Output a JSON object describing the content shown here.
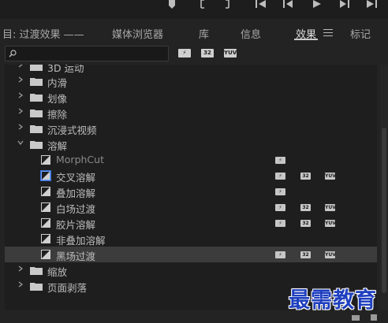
{
  "tabs": [
    {
      "label": "目: 过渡效果 ——",
      "active": false
    },
    {
      "label": "媒体浏览器",
      "active": false
    },
    {
      "label": "库",
      "active": false
    },
    {
      "label": "信息",
      "active": false
    },
    {
      "label": "效果",
      "active": true
    },
    {
      "label": "标记",
      "active": false
    }
  ],
  "toolbar": {
    "search_value": "",
    "filters": [
      "accelerated-effects",
      "32-bit-color",
      "yuv"
    ]
  },
  "badges": {
    "fx": "⚡",
    "b32": "32",
    "yuv": "YUV"
  },
  "tree": [
    {
      "type": "folder",
      "label": "3D 运动",
      "expanded": false,
      "clipped": true
    },
    {
      "type": "folder",
      "label": "内滑",
      "expanded": false
    },
    {
      "type": "folder",
      "label": "划像",
      "expanded": false
    },
    {
      "type": "folder",
      "label": "擦除",
      "expanded": false
    },
    {
      "type": "folder",
      "label": "沉浸式视频",
      "expanded": false
    },
    {
      "type": "folder",
      "label": "溶解",
      "expanded": true
    },
    {
      "type": "effect",
      "label": "MorphCut",
      "badges": [
        "fx"
      ]
    },
    {
      "type": "effect",
      "label": "交叉溶解",
      "badges": [
        "fx",
        "b32",
        "yuv"
      ],
      "highlighted": true
    },
    {
      "type": "effect",
      "label": "叠加溶解",
      "badges": [
        "fx"
      ]
    },
    {
      "type": "effect",
      "label": "白场过渡",
      "badges": [
        "fx",
        "b32",
        "yuv"
      ]
    },
    {
      "type": "effect",
      "label": "胶片溶解",
      "badges": [
        "fx",
        "b32",
        "yuv"
      ]
    },
    {
      "type": "effect",
      "label": "非叠加溶解",
      "badges": []
    },
    {
      "type": "effect",
      "label": "黑场过渡",
      "badges": [
        "fx",
        "b32",
        "yuv"
      ],
      "selected": true
    },
    {
      "type": "folder",
      "label": "缩放",
      "expanded": false
    },
    {
      "type": "folder",
      "label": "页面剥落",
      "expanded": false
    }
  ],
  "watermark": "最需教育",
  "colors": {
    "panel_bg": "#1e1e1e",
    "selected_row": "#3c3c3c",
    "watermark": "#1f3fbf"
  }
}
